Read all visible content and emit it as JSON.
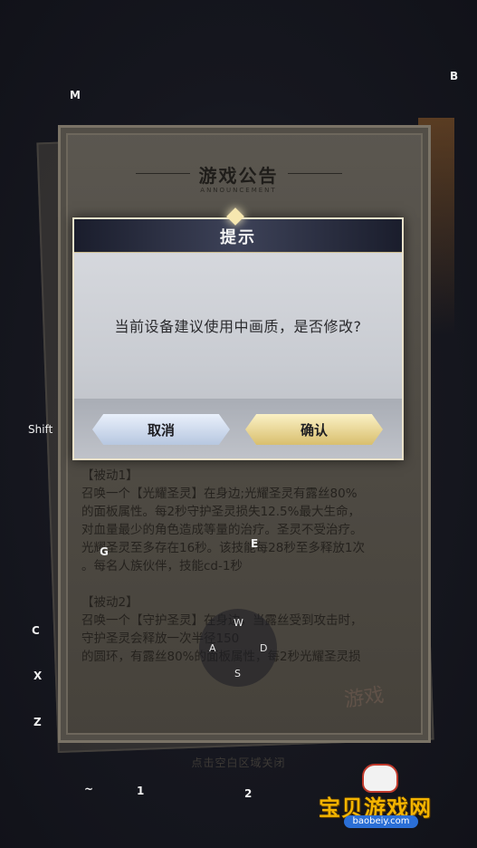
{
  "board": {
    "title": "游戏公告",
    "subtitle": "ANNOUNCEMENT",
    "passive1": {
      "heading": "【被动1】",
      "lines": [
        "召唤一个【光耀圣灵】在身边;光耀圣灵有露丝80%",
        "的面板属性。每2秒守护圣灵损失12.5%最大生命，",
        "对血量最少的角色造成等量的治疗。圣灵不受治疗。",
        "光耀圣灵至多存在16秒。该技能每28秒至多释放1次",
        "。每名人族伙伴，技能cd-1秒"
      ]
    },
    "passive2": {
      "heading": "【被动2】",
      "lines": [
        "召唤一个【守护圣灵】在身边，当露丝受到攻击时，",
        "守护圣灵会释放一次半径150",
        "的圆环，有露丝80%的面板属性，每2秒光耀圣灵损"
      ]
    },
    "footer": "点击空白区域关闭",
    "stamp": "游戏"
  },
  "dialog": {
    "title": "提示",
    "message": "当前设备建议使用中画质，是否修改?",
    "cancel_label": "取消",
    "confirm_label": "确认"
  },
  "keys": {
    "m": "M",
    "b": "B",
    "shift": "Shift",
    "g": "G",
    "e": "E",
    "c": "C",
    "x": "X",
    "z": "Z",
    "tilde": "~",
    "one": "1",
    "two": "2",
    "joystick": {
      "w": "W",
      "a": "A",
      "s": "S",
      "d": "D"
    }
  },
  "site": {
    "name": "宝贝游戏网",
    "url": "baobeiy.com"
  }
}
